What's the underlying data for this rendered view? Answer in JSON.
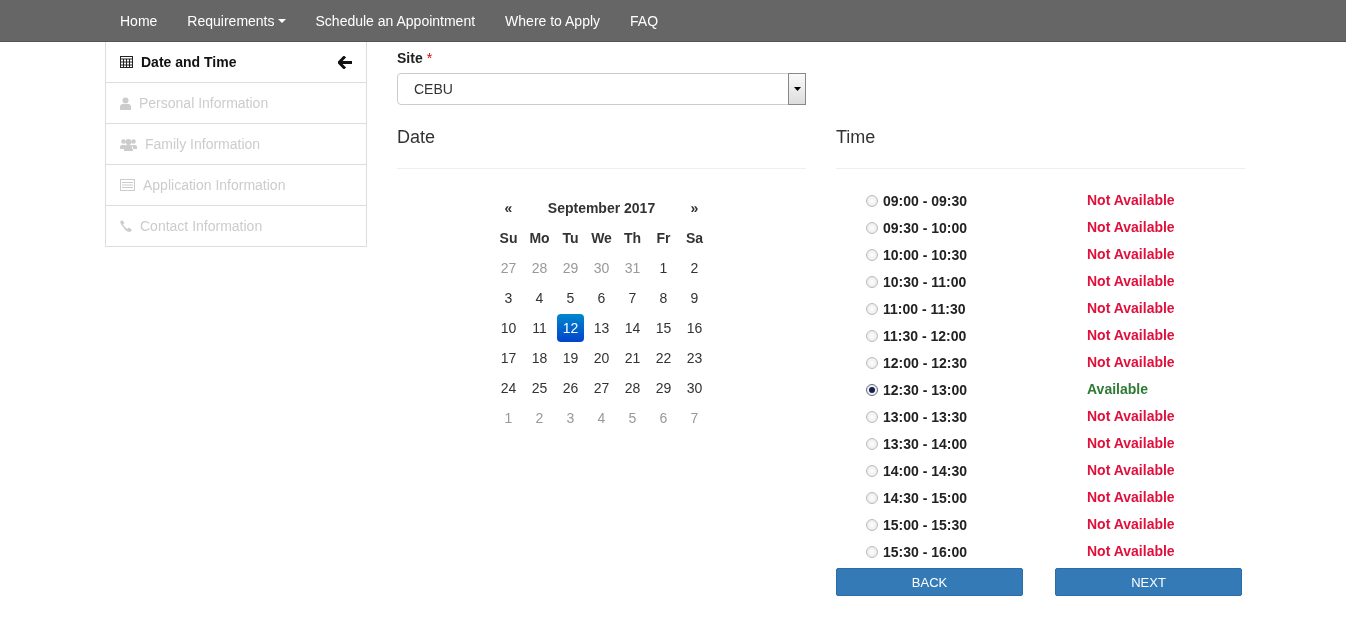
{
  "nav": {
    "items": [
      {
        "label": "Home",
        "dropdown": false
      },
      {
        "label": "Requirements",
        "dropdown": true
      },
      {
        "label": "Schedule an Appointment",
        "dropdown": false
      },
      {
        "label": "Where to Apply",
        "dropdown": false
      },
      {
        "label": "FAQ",
        "dropdown": false
      }
    ]
  },
  "sidebar": {
    "items": [
      {
        "label": "Date and Time",
        "selected": true
      },
      {
        "label": "Personal Information",
        "selected": false
      },
      {
        "label": "Family Information",
        "selected": false
      },
      {
        "label": "Application Information",
        "selected": false
      },
      {
        "label": "Contact Information",
        "selected": false
      }
    ]
  },
  "site": {
    "label": "Site",
    "required_mark": "*",
    "value": "CEBU"
  },
  "date": {
    "heading": "Date",
    "prev": "«",
    "next": "»",
    "month": "September 2017",
    "weekdays": [
      "Su",
      "Mo",
      "Tu",
      "We",
      "Th",
      "Fr",
      "Sa"
    ],
    "days": [
      {
        "d": "27",
        "muted": true,
        "selected": false
      },
      {
        "d": "28",
        "muted": true,
        "selected": false
      },
      {
        "d": "29",
        "muted": true,
        "selected": false
      },
      {
        "d": "30",
        "muted": true,
        "selected": false
      },
      {
        "d": "31",
        "muted": true,
        "selected": false
      },
      {
        "d": "1",
        "muted": false,
        "selected": false
      },
      {
        "d": "2",
        "muted": false,
        "selected": false
      },
      {
        "d": "3",
        "muted": false,
        "selected": false
      },
      {
        "d": "4",
        "muted": false,
        "selected": false
      },
      {
        "d": "5",
        "muted": false,
        "selected": false
      },
      {
        "d": "6",
        "muted": false,
        "selected": false
      },
      {
        "d": "7",
        "muted": false,
        "selected": false
      },
      {
        "d": "8",
        "muted": false,
        "selected": false
      },
      {
        "d": "9",
        "muted": false,
        "selected": false
      },
      {
        "d": "10",
        "muted": false,
        "selected": false
      },
      {
        "d": "11",
        "muted": false,
        "selected": false
      },
      {
        "d": "12",
        "muted": false,
        "selected": true
      },
      {
        "d": "13",
        "muted": false,
        "selected": false
      },
      {
        "d": "14",
        "muted": false,
        "selected": false
      },
      {
        "d": "15",
        "muted": false,
        "selected": false
      },
      {
        "d": "16",
        "muted": false,
        "selected": false
      },
      {
        "d": "17",
        "muted": false,
        "selected": false
      },
      {
        "d": "18",
        "muted": false,
        "selected": false
      },
      {
        "d": "19",
        "muted": false,
        "selected": false
      },
      {
        "d": "20",
        "muted": false,
        "selected": false
      },
      {
        "d": "21",
        "muted": false,
        "selected": false
      },
      {
        "d": "22",
        "muted": false,
        "selected": false
      },
      {
        "d": "23",
        "muted": false,
        "selected": false
      },
      {
        "d": "24",
        "muted": false,
        "selected": false
      },
      {
        "d": "25",
        "muted": false,
        "selected": false
      },
      {
        "d": "26",
        "muted": false,
        "selected": false
      },
      {
        "d": "27",
        "muted": false,
        "selected": false
      },
      {
        "d": "28",
        "muted": false,
        "selected": false
      },
      {
        "d": "29",
        "muted": false,
        "selected": false
      },
      {
        "d": "30",
        "muted": false,
        "selected": false
      },
      {
        "d": "1",
        "muted": true,
        "selected": false
      },
      {
        "d": "2",
        "muted": true,
        "selected": false
      },
      {
        "d": "3",
        "muted": true,
        "selected": false
      },
      {
        "d": "4",
        "muted": true,
        "selected": false
      },
      {
        "d": "5",
        "muted": true,
        "selected": false
      },
      {
        "d": "6",
        "muted": true,
        "selected": false
      },
      {
        "d": "7",
        "muted": true,
        "selected": false
      }
    ]
  },
  "time": {
    "heading": "Time",
    "slots": [
      {
        "time": "09:00 - 09:30",
        "status": "Not Available",
        "kind": "unavailable",
        "selected": false
      },
      {
        "time": "09:30 - 10:00",
        "status": "Not Available",
        "kind": "unavailable",
        "selected": false
      },
      {
        "time": "10:00 - 10:30",
        "status": "Not Available",
        "kind": "unavailable",
        "selected": false
      },
      {
        "time": "10:30 - 11:00",
        "status": "Not Available",
        "kind": "unavailable",
        "selected": false
      },
      {
        "time": "11:00 - 11:30",
        "status": "Not Available",
        "kind": "unavailable",
        "selected": false
      },
      {
        "time": "11:30 - 12:00",
        "status": "Not Available",
        "kind": "unavailable",
        "selected": false
      },
      {
        "time": "12:00 - 12:30",
        "status": "Not Available",
        "kind": "unavailable",
        "selected": false
      },
      {
        "time": "12:30 - 13:00",
        "status": "Available",
        "kind": "available",
        "selected": true
      },
      {
        "time": "13:00 - 13:30",
        "status": "Not Available",
        "kind": "unavailable",
        "selected": false
      },
      {
        "time": "13:30 - 14:00",
        "status": "Not Available",
        "kind": "unavailable",
        "selected": false
      },
      {
        "time": "14:00 - 14:30",
        "status": "Not Available",
        "kind": "unavailable",
        "selected": false
      },
      {
        "time": "14:30 - 15:00",
        "status": "Not Available",
        "kind": "unavailable",
        "selected": false
      },
      {
        "time": "15:00 - 15:30",
        "status": "Not Available",
        "kind": "unavailable",
        "selected": false
      },
      {
        "time": "15:30 - 16:00",
        "status": "Not Available",
        "kind": "unavailable",
        "selected": false
      }
    ]
  },
  "buttons": [
    "BACK",
    "NEXT"
  ]
}
